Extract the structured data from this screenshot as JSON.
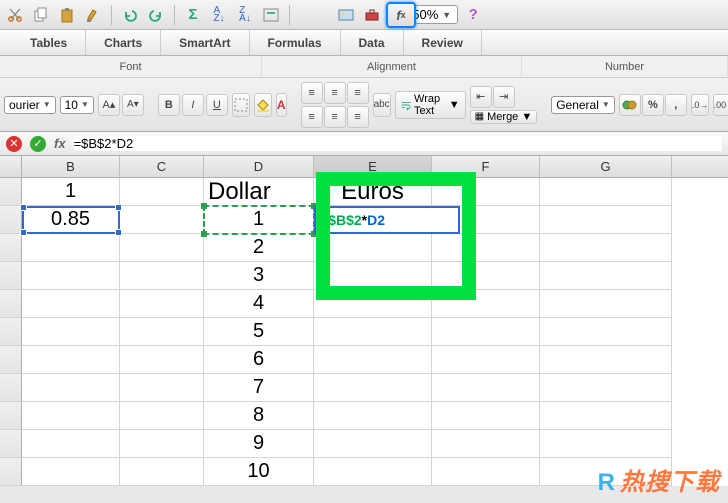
{
  "toolbar": {
    "zoom": "150%",
    "icons": [
      "cut",
      "copy",
      "paste",
      "format-painter",
      "undo",
      "redo",
      "sum",
      "sort-asc",
      "sort-desc",
      "filter",
      "fx",
      "gallery",
      "toolbox",
      "help"
    ]
  },
  "ribbon": {
    "tabs": [
      "Tables",
      "Charts",
      "SmartArt",
      "Formulas",
      "Data",
      "Review"
    ],
    "groups": [
      "Font",
      "Alignment",
      "Number"
    ],
    "font_name": "ourier",
    "font_size": "10",
    "wrap_label": "Wrap Text",
    "merge_label": "Merge",
    "abc_label": "abc",
    "number_format": "General"
  },
  "formats": {
    "bold": "B",
    "italic": "I",
    "underline": "U"
  },
  "formula_bar": {
    "value": "=$B$2*D2"
  },
  "columns": [
    "B",
    "C",
    "D",
    "E",
    "F",
    "G"
  ],
  "active_column_index": 3,
  "headers": {
    "D": "Dollar",
    "E": "Euros"
  },
  "cells": {
    "B1": "1",
    "B2": "0.85",
    "D_values": [
      "1",
      "2",
      "3",
      "4",
      "5",
      "6",
      "7",
      "8",
      "9",
      "10"
    ]
  },
  "edit_cell": {
    "eq": "=",
    "ref1": "$B$2",
    "op": " *",
    "ref2": "D2"
  },
  "watermark": {
    "r": "R",
    "text": "热搜下载"
  }
}
